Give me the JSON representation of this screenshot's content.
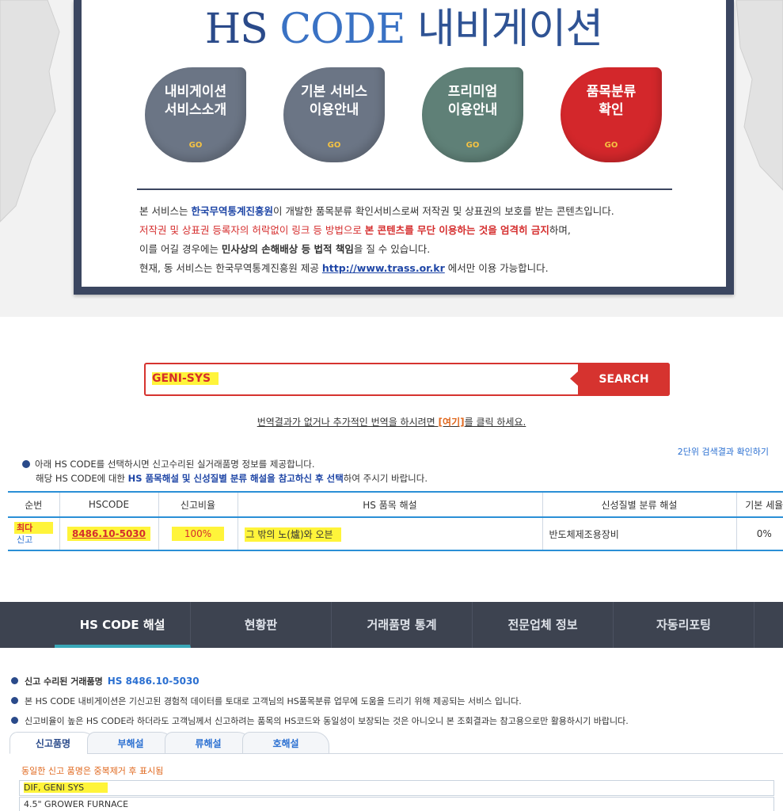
{
  "banner": {
    "title_hs": "HS",
    "title_code": "CODE",
    "title_kor": "내비게이션",
    "cards": [
      {
        "label": "내비게이션\n서비스소개",
        "go": "GO"
      },
      {
        "label": "기본 서비스\n이용안내",
        "go": "GO"
      },
      {
        "label": "프리미엄\n이용안내",
        "go": "GO"
      },
      {
        "label": "품목분류\n확인",
        "go": "GO"
      }
    ],
    "notice": {
      "l1_a": "본 서비스는 ",
      "l1_b": "한국무역통계진흥원",
      "l1_c": "이 개발한 품목분류 확인서비스로써 저작권 및 상표권의 보호를 받는 콘텐츠입니다.",
      "l2_a": "저작권 및 상표권 등록자의 허락없이 링크 등 방법으로 ",
      "l2_b": "본 콘텐츠를 무단 이용하는 것을 엄격히 금지",
      "l2_c": "하며,",
      "l3_a": "이를 어길 경우에는 ",
      "l3_b": "민사상의 손해배상 등 법적 책임",
      "l3_c": "을 질 수 있습니다.",
      "l4_a": "현재, 동 서비스는 한국무역통계진흥원 제공  ",
      "l4_b": "http://www.trass.or.kr",
      "l4_c": " 에서만 이용 가능합니다."
    }
  },
  "search": {
    "value": "GENI-SYS",
    "button": "SEARCH",
    "trans_a": "번역결과가 없거나 추가적인 번역을 하시려면 ",
    "trans_b": "[여기]",
    "trans_c": "를 클릭 하세요."
  },
  "results": {
    "level2_link": "2단위 검색결과 확인하기",
    "guide1": "아래 HS CODE를 선택하시면 신고수리된 실거래품명 정보를 제공합니다.",
    "guide2_a": "해당 HS CODE에 대한 ",
    "guide2_b": "HS 품목해설 및 신성질별 분류 해설을 참고하신 후 선택",
    "guide2_c": "하여 주시기 바랍니다.",
    "headers": [
      "순번",
      "HSCODE",
      "신고비율",
      "HS 품목 해설",
      "신성질별 분류 해설",
      "기본 세율"
    ],
    "row": {
      "rank1": "최다",
      "rank2": "신고",
      "hscode": "8486.10-5030",
      "ratio": "100%",
      "desc": "그 밖의 노(爐)와 오븐",
      "class": "반도체제조용장비",
      "rate": "0%"
    }
  },
  "nav": {
    "tabs": [
      "HS CODE 해설",
      "현황판",
      "거래품명 통계",
      "전문업체 정보",
      "자동리포팅"
    ]
  },
  "detail": {
    "d1_label": "신고 수리된 거래품명",
    "d1_hs": "HS 8486.10-5030",
    "d2": "본 HS CODE 내비게이션은 기신고된 경험적 데이터를 토대로 고객님의 HS품목분류 업무에 도움을 드리기 위해 제공되는 서비스 입니다.",
    "d3": "신고비율이 높은 HS CODE라 하더라도 고객님께서 신고하려는 품목의 HS코드와 동일성이 보장되는 것은 아니오니 본 조회결과는 참고용으로만 활용하시기 바랍니다.",
    "subtabs": [
      "신고품명",
      "부해설",
      "류해설",
      "호해설"
    ],
    "dup_note": "동일한 신고 품명은 중복제거 후 표시됨",
    "items": [
      "DIF, GENI SYS",
      "4.5\" GROWER FURNACE"
    ]
  }
}
